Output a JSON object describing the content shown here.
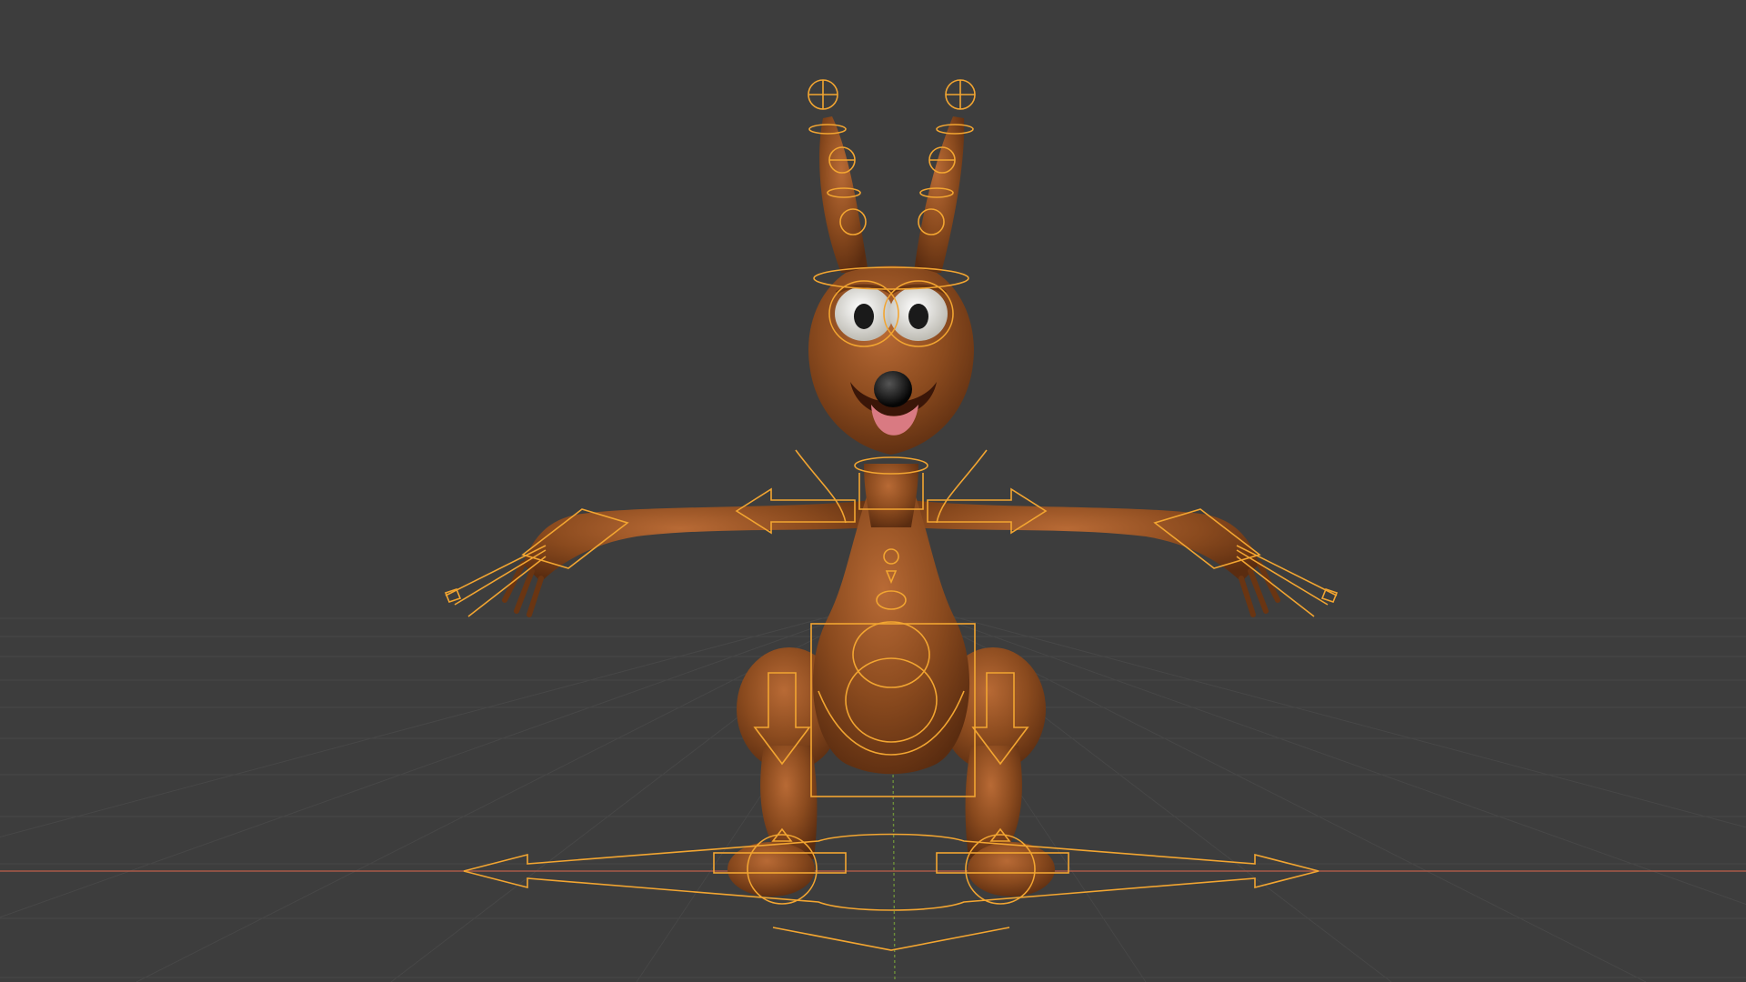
{
  "viewport": {
    "background_color": "#3d3d3d",
    "grid_color": "#4a4a4a",
    "x_axis_color": "#b0574a",
    "y_axis_color": "#6c8e3a",
    "character_color": "#8a4a1e",
    "character_shadow_color": "#5e2e10",
    "rig_color": "#f2a531",
    "eye_white_color": "#ecebe6",
    "tongue_color": "#d97a82",
    "nose_color": "#111111"
  }
}
